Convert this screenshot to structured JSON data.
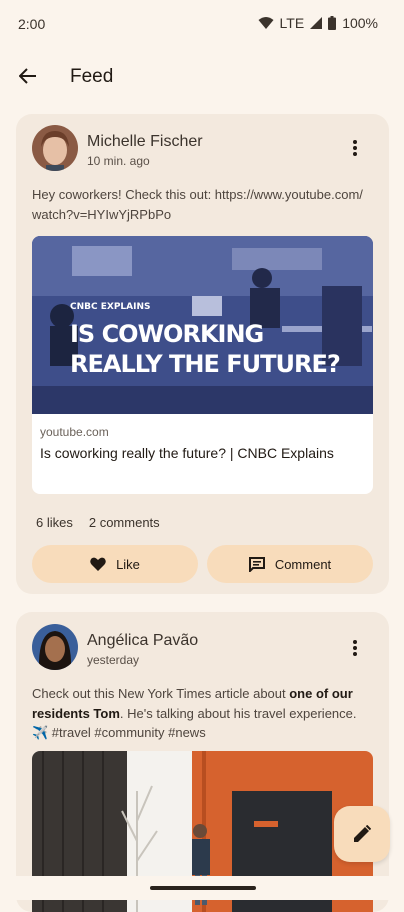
{
  "status": {
    "time": "2:00",
    "network": "LTE",
    "battery": "100%"
  },
  "appbar": {
    "title": "Feed",
    "back_icon": "arrow-back-icon"
  },
  "posts": [
    {
      "author": "Michelle Fischer",
      "time": "10 min. ago",
      "text": "Hey coworkers! Check this out: https://www.youtube.com/watch?v=HYIwYjRPbPo",
      "preview": {
        "overlay_tag": "CNBC EXPLAINS",
        "overlay_headline": "IS COWORKING REALLY THE FUTURE?",
        "domain": "youtube.com",
        "title": "Is coworking really the future? | CNBC Explains"
      },
      "likes": "6 likes",
      "comments": "2 comments",
      "like_label": "Like",
      "comment_label": "Comment"
    },
    {
      "author": "Angélica Pavão",
      "time": "yesterday",
      "text_part1": "Check out this New York Times article about ",
      "text_bold": "one of our residents Tom",
      "text_part2": ". He's talking about his travel experience. ✈️ #travel #community #news"
    }
  ],
  "colors": {
    "background": "#fbf4ec",
    "card": "#f3e9de",
    "button": "#f8dcbb",
    "accent_orange": "#d6622e"
  },
  "fab": {
    "icon": "edit-icon"
  }
}
